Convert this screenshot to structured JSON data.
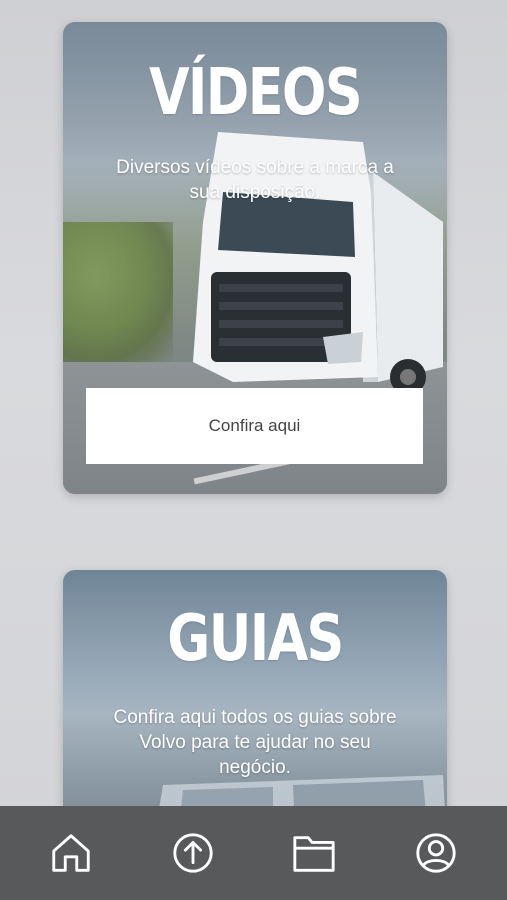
{
  "videos_card": {
    "title": "VÍDEOS",
    "description": "Diversos vídeos sobre a marca a sua disposição.",
    "button_label": "Confira aqui"
  },
  "guias_card": {
    "title": "GUIAS",
    "description": "Confira aqui todos os guias sobre Volvo para te ajudar no seu negócio."
  },
  "tabbar": {
    "background": "#58595b",
    "icons": [
      "home-icon",
      "upload-icon",
      "folder-icon",
      "profile-icon"
    ]
  }
}
